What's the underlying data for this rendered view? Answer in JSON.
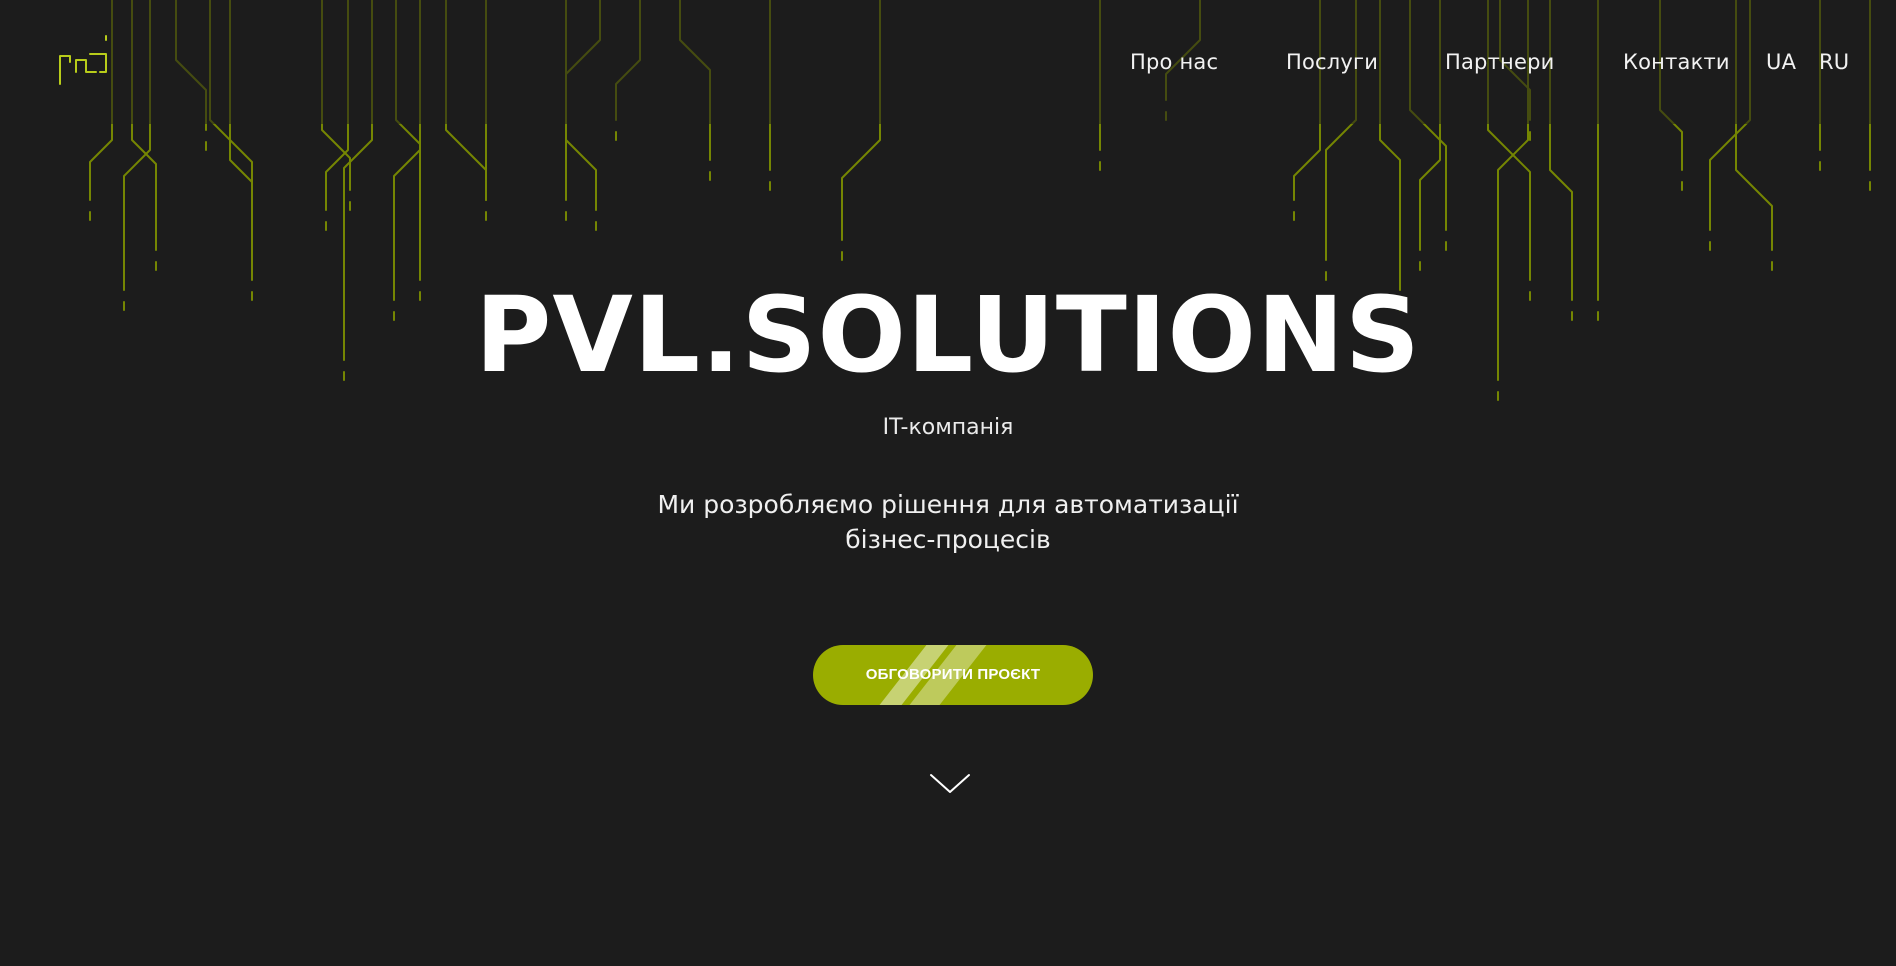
{
  "brand": {
    "logo_icon": "psl-logo-icon",
    "accent_color": "#9aad00",
    "line_color": "#6e7e00",
    "background_color": "#1c1c1c"
  },
  "nav": {
    "items": [
      {
        "label": "Про нас"
      },
      {
        "label": "Послуги"
      },
      {
        "label": "Партнери"
      },
      {
        "label": "Контакти"
      }
    ],
    "languages": [
      "UA",
      "RU"
    ]
  },
  "hero": {
    "title": "PVL.SOLUTIONS",
    "subtitle": "IT-компанія",
    "description_line1": "Ми розробляємо рішення для автоматизації",
    "description_line2": "бізнес-процесів",
    "cta_label": "ОБГОВОРИТИ ПРОЄКТ",
    "scroll_icon": "chevron-down-icon"
  }
}
